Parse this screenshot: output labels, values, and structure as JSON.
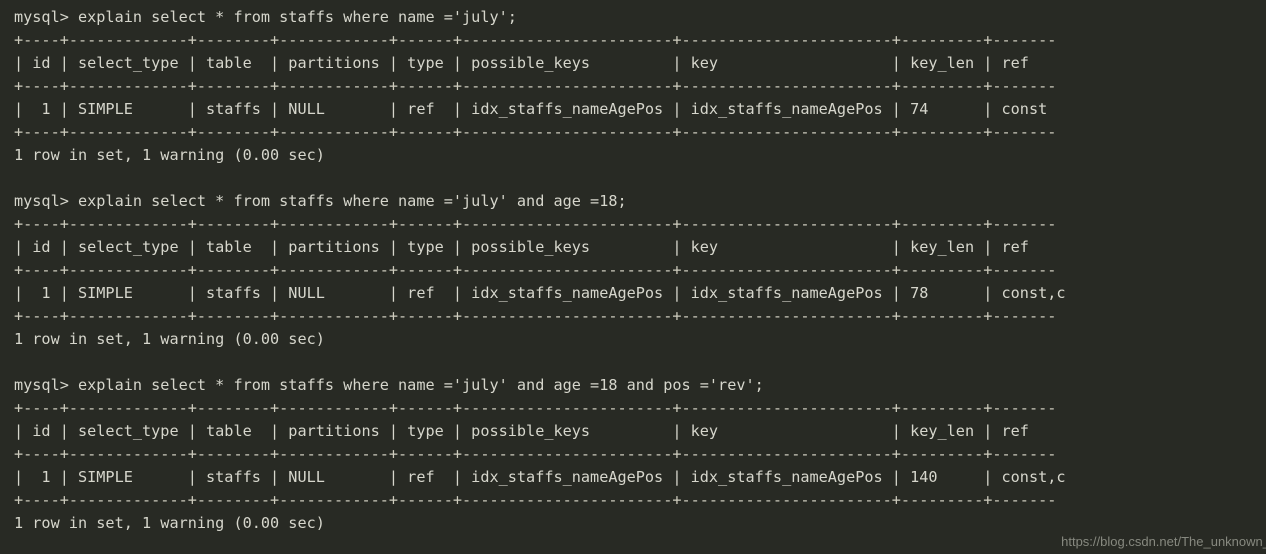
{
  "terminal": {
    "background_color": "#282a24",
    "foreground_color": "#d6d6cc",
    "prompt": "mysql>",
    "lines": [
      "mysql> explain select * from staffs where name ='july';",
      "+----+-------------+--------+------------+------+-----------------------+-----------------------+---------+-------",
      "| id | select_type | table  | partitions | type | possible_keys         | key                   | key_len | ref   ",
      "+----+-------------+--------+------------+------+-----------------------+-----------------------+---------+-------",
      "|  1 | SIMPLE      | staffs | NULL       | ref  | idx_staffs_nameAgePos | idx_staffs_nameAgePos | 74      | const ",
      "+----+-------------+--------+------------+------+-----------------------+-----------------------+---------+-------",
      "1 row in set, 1 warning (0.00 sec)",
      "",
      "mysql> explain select * from staffs where name ='july' and age =18;",
      "+----+-------------+--------+------------+------+-----------------------+-----------------------+---------+-------",
      "| id | select_type | table  | partitions | type | possible_keys         | key                   | key_len | ref   ",
      "+----+-------------+--------+------------+------+-----------------------+-----------------------+---------+-------",
      "|  1 | SIMPLE      | staffs | NULL       | ref  | idx_staffs_nameAgePos | idx_staffs_nameAgePos | 78      | const,c",
      "+----+-------------+--------+------------+------+-----------------------+-----------------------+---------+-------",
      "1 row in set, 1 warning (0.00 sec)",
      "",
      "mysql> explain select * from staffs where name ='july' and age =18 and pos ='rev';",
      "+----+-------------+--------+------------+------+-----------------------+-----------------------+---------+-------",
      "| id | select_type | table  | partitions | type | possible_keys         | key                   | key_len | ref   ",
      "+----+-------------+--------+------------+------+-----------------------+-----------------------+---------+-------",
      "|  1 | SIMPLE      | staffs | NULL       | ref  | idx_staffs_nameAgePos | idx_staffs_nameAgePos | 140     | const,c",
      "+----+-------------+--------+------------+------+-----------------------+-----------------------+---------+-------",
      "1 row in set, 1 warning (0.00 sec)"
    ],
    "queries": [
      {
        "sql": "explain select * from staffs where name ='july';",
        "columns": [
          "id",
          "select_type",
          "table",
          "partitions",
          "type",
          "possible_keys",
          "key",
          "key_len",
          "ref"
        ],
        "row": [
          "1",
          "SIMPLE",
          "staffs",
          "NULL",
          "ref",
          "idx_staffs_nameAgePos",
          "idx_staffs_nameAgePos",
          "74",
          "const"
        ],
        "status": "1 row in set, 1 warning (0.00 sec)"
      },
      {
        "sql": "explain select * from staffs where name ='july' and age =18;",
        "columns": [
          "id",
          "select_type",
          "table",
          "partitions",
          "type",
          "possible_keys",
          "key",
          "key_len",
          "ref"
        ],
        "row": [
          "1",
          "SIMPLE",
          "staffs",
          "NULL",
          "ref",
          "idx_staffs_nameAgePos",
          "idx_staffs_nameAgePos",
          "78",
          "const,c"
        ],
        "status": "1 row in set, 1 warning (0.00 sec)"
      },
      {
        "sql": "explain select * from staffs where name ='july' and age =18 and pos ='rev';",
        "columns": [
          "id",
          "select_type",
          "table",
          "partitions",
          "type",
          "possible_keys",
          "key",
          "key_len",
          "ref"
        ],
        "row": [
          "1",
          "SIMPLE",
          "staffs",
          "NULL",
          "ref",
          "idx_staffs_nameAgePos",
          "idx_staffs_nameAgePos",
          "140",
          "const,c"
        ],
        "status": "1 row in set, 1 warning (0.00 sec)"
      }
    ]
  },
  "watermark": {
    "text": "https://blog.csdn.net/The_unknown_"
  }
}
